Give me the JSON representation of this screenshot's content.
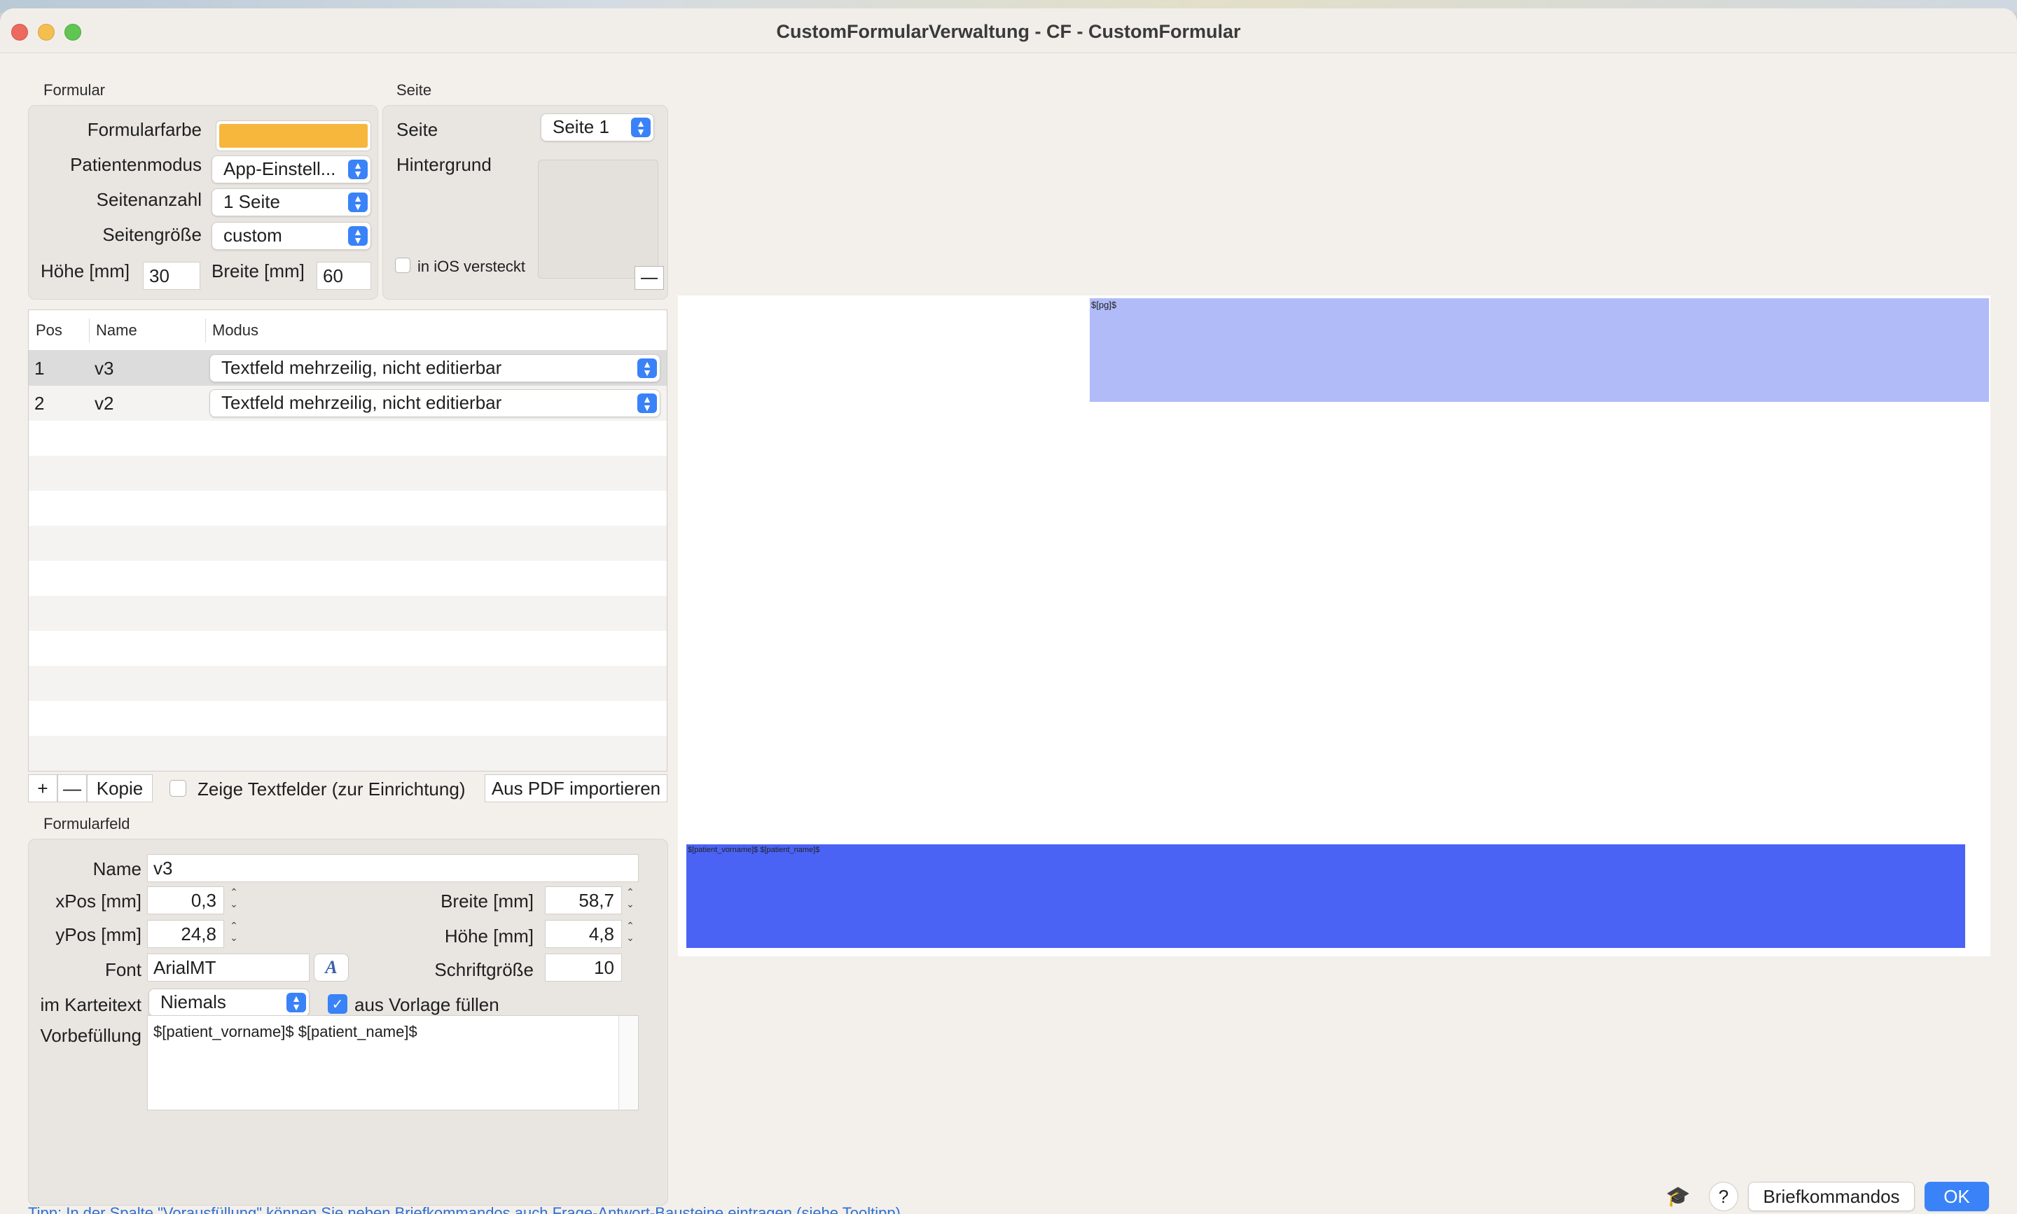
{
  "window": {
    "title": "CustomFormularVerwaltung - CF - CustomFormular"
  },
  "formular": {
    "section_label": "Formular",
    "formularfarbe_label": "Formularfarbe",
    "formularfarbe_color": "#f6b73c",
    "patientenmodus_label": "Patientenmodus",
    "patientenmodus_value": "App-Einstell...",
    "seitenanzahl_label": "Seitenanzahl",
    "seitenanzahl_value": "1 Seite",
    "seitengroesse_label": "Seitengröße",
    "seitengroesse_value": "custom",
    "hoehe_label": "Höhe [mm]",
    "hoehe_value": "30",
    "breite_label": "Breite [mm]",
    "breite_value": "60"
  },
  "seite": {
    "section_label": "Seite",
    "seite_label": "Seite",
    "seite_value": "Seite 1",
    "hintergrund_label": "Hintergrund",
    "ios_label": "in iOS versteckt",
    "remove_label": "—"
  },
  "table": {
    "headers": [
      "Pos",
      "Name",
      "Modus"
    ],
    "rows": [
      {
        "pos": "1",
        "name": "v3",
        "modus": "Textfeld mehrzeilig, nicht editierbar"
      },
      {
        "pos": "2",
        "name": "v2",
        "modus": "Textfeld mehrzeilig, nicht editierbar"
      }
    ],
    "add_label": "+",
    "remove_label": "—",
    "copy_label": "Kopie",
    "show_fields_label": "Zeige Textfelder (zur Einrichtung)",
    "import_label": "Aus PDF importieren"
  },
  "formularfeld": {
    "section_label": "Formularfeld",
    "name_label": "Name",
    "name_value": "v3",
    "xpos_label": "xPos [mm]",
    "xpos_value": "0,3",
    "ypos_label": "yPos [mm]",
    "ypos_value": "24,8",
    "breite_label": "Breite [mm]",
    "breite_value": "58,7",
    "hoehe_label": "Höhe [mm]",
    "hoehe_value": "4,8",
    "font_label": "Font",
    "font_value": "ArialMT",
    "font_button": "A",
    "schriftgroesse_label": "Schriftgröße",
    "schriftgroesse_value": "10",
    "karteitext_label": "im Karteitext",
    "karteitext_value": "Niemals",
    "aus_vorlage_label": "aus Vorlage füllen",
    "vorbefuellung_label": "Vorbefüllung",
    "vorbefuellung_value": "$[patient_vorname]$ $[patient_name]$"
  },
  "preview": {
    "field1_text": "$[pg]$",
    "field1_color": "#b1bbf8",
    "field2_text": "$[patient_vorname]$ $[patient_name]$",
    "field2_color": "#4a63f5"
  },
  "bottom": {
    "help_label": "?",
    "briefkommandos_label": "Briefkommandos",
    "ok_label": "OK",
    "tip": "Tipp: In der Spalte \"Vorausfüllung\" können Sie neben Briefkommandos auch Frage-Antwort-Bausteine eintragen (siehe Tooltipp)"
  }
}
